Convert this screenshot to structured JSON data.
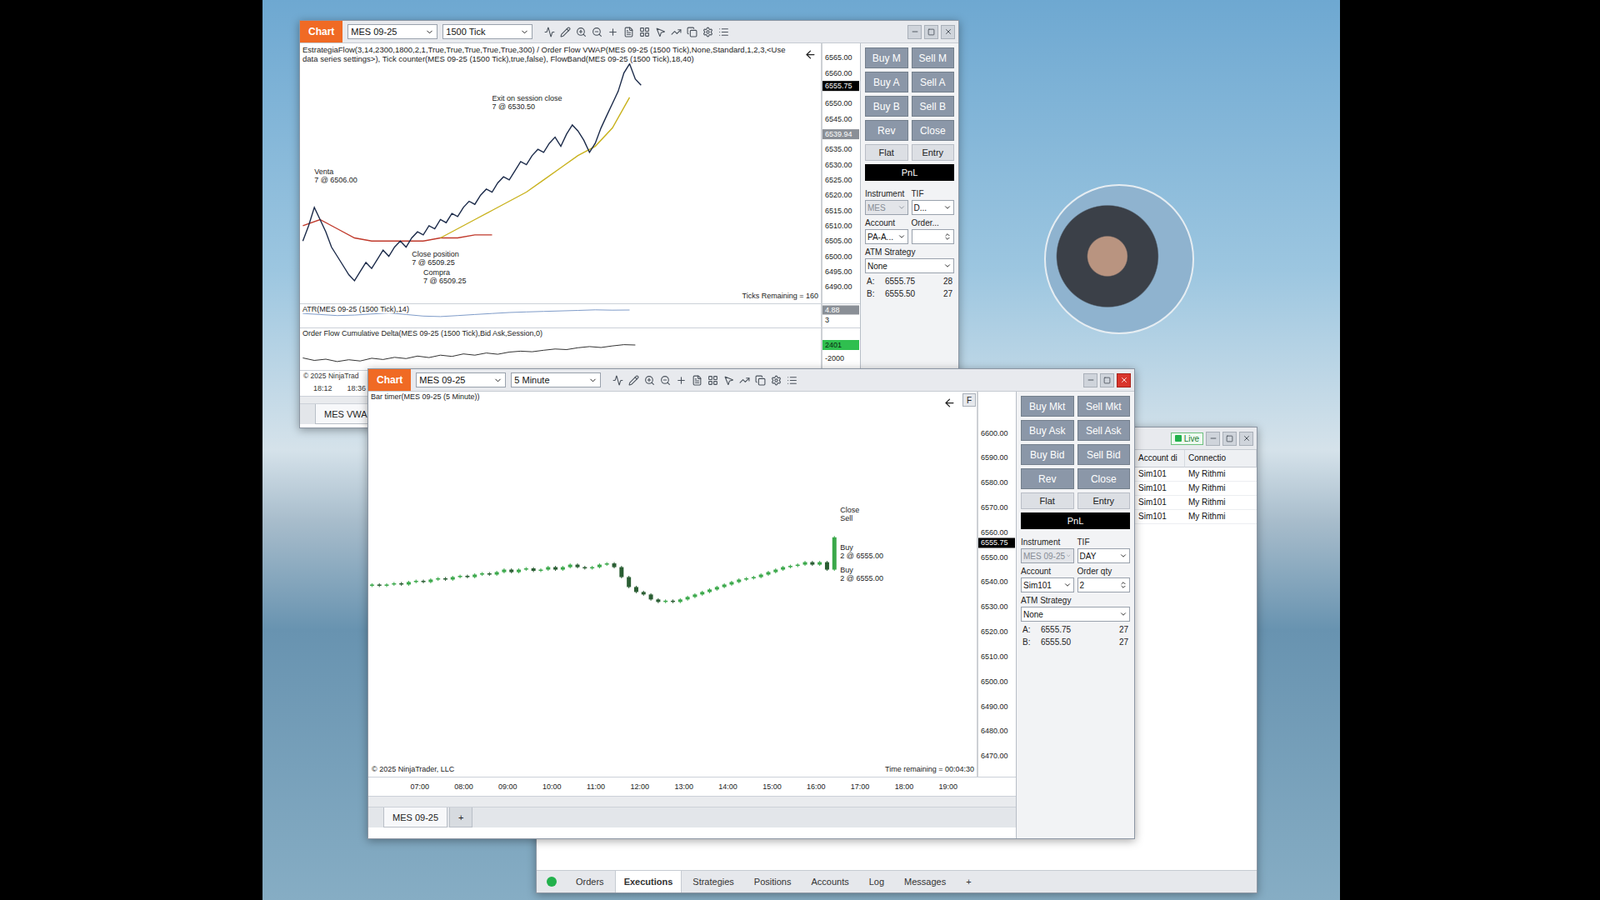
{
  "tick_chart": {
    "title": "Chart",
    "instrument": "MES 09-25",
    "interval": "1500 Tick",
    "indicator_label": "EstrategiaFlow(3,14,2300,1800,2,1,True,True,True,True,True,300) / Order Flow VWAP(MES 09-25 (1500 Tick),None,Standard,1,2,3,<Use data series settings>), Tick counter(MES 09-25 (1500 Tick),true,false), FlowBand(MES 09-25 (1500 Tick),18,40)",
    "bar_slots": 91,
    "price_axis": {
      "min": 6484.6,
      "max": 6569.7,
      "ticks": [
        "6565.00",
        "6560.00",
        "6550.00",
        "6545.00",
        "6535.00",
        "6530.00",
        "6525.00",
        "6520.00",
        "6515.00",
        "6510.00",
        "6505.00",
        "6500.00",
        "6495.00",
        "6490.00"
      ],
      "markers": [
        {
          "text": "6555.75",
          "price": 6555.75,
          "color": "#000000"
        },
        {
          "text": "6539.94",
          "price": 6539.94,
          "color": "#8a8f96"
        }
      ]
    },
    "series": [
      {
        "color": "#c0392b",
        "start_bar": 0,
        "bar_step": 3,
        "values": [
          6510,
          6512,
          6509,
          6506,
          6505,
          6505,
          6505,
          6505,
          6506,
          6506,
          6507,
          6507
        ]
      },
      {
        "color": "#c9b21c",
        "start_bar": 24,
        "bar_step": 3,
        "values": [
          6506,
          6509,
          6512,
          6515,
          6518,
          6521,
          6525,
          6529,
          6533,
          6536,
          6542,
          6552
        ]
      },
      {
        "color": "#1c2b4a",
        "start_bar": 0,
        "bar_step": 1,
        "values": [
          6505,
          6510,
          6516,
          6512,
          6508,
          6503,
          6500,
          6497,
          6494,
          6492,
          6495,
          6498,
          6496,
          6499,
          6502,
          6500,
          6503,
          6505,
          6503,
          6506,
          6508,
          6507,
          6510,
          6509,
          6512,
          6511,
          6514,
          6513,
          6516,
          6518,
          6517,
          6520,
          6522,
          6521,
          6524,
          6526,
          6525,
          6528,
          6531,
          6530,
          6533,
          6535,
          6534,
          6537,
          6539,
          6536,
          6540,
          6543,
          6541,
          6538,
          6534,
          6537,
          6542,
          6546,
          6550,
          6554,
          6560,
          6563,
          6558,
          6556
        ]
      }
    ],
    "annotations": [
      {
        "lines": [
          "Venta",
          "7 @ 6506.00"
        ],
        "bar": 2,
        "price": 6527
      },
      {
        "lines": [
          "Exit on session close",
          "7 @ 6530.50"
        ],
        "bar": 33,
        "price": 6551
      },
      {
        "lines": [
          "Close position",
          "7 @ 6509.25"
        ],
        "bar": 19,
        "price": 6500
      },
      {
        "lines": [
          "Compra",
          "7 @ 6509.25"
        ],
        "bar": 21,
        "price": 6494
      }
    ],
    "ticks_remaining": "Ticks Remaining = 160",
    "atr": {
      "label": "ATR(MES 09-25 (1500 Tick),14)",
      "min": 1.5,
      "max": 6.0,
      "axis": [
        {
          "text": "4.88",
          "value": 4.88,
          "highlight": true
        },
        {
          "text": "3",
          "value": 3,
          "highlight": false
        }
      ],
      "start_bar": 0,
      "bar_step": 3,
      "values": [
        4.2,
        4.0,
        3.8,
        3.9,
        4.1,
        4.3,
        4.0,
        3.7,
        3.6,
        3.8,
        4.0,
        4.2,
        4.4,
        4.5,
        4.6,
        4.7,
        4.8,
        4.9,
        4.85,
        4.88
      ]
    },
    "delta": {
      "label": "Order Flow Cumulative Delta(MES 09-25 (1500 Tick),Bid Ask,Session,0)",
      "min": -5724,
      "max": 7818,
      "marker": {
        "text": "2401",
        "value": 2401,
        "color": "#2fbf4f"
      },
      "axis": [
        {
          "text": "-2000",
          "value": -2000
        }
      ],
      "start_bar": 0,
      "bar_step": 2,
      "values": [
        -1800,
        -2600,
        -2200,
        -3000,
        -2400,
        -2800,
        -1900,
        -2300,
        -1600,
        -2000,
        -1200,
        -1700,
        -900,
        -1300,
        -500,
        -900,
        -200,
        -600,
        100,
        400,
        200,
        700,
        1100,
        900,
        1500,
        1900,
        1600,
        2100,
        2500,
        2401
      ]
    },
    "copyright": "© 2025 NinjaTrad",
    "time_axis": [
      "18:12",
      "18:36"
    ],
    "tabs": [
      {
        "label": "MES VWA",
        "selected": true
      }
    ],
    "trade_panel": {
      "order_buttons": [
        "Buy M",
        "Sell M",
        "Buy A",
        "Sell A",
        "Buy B",
        "Sell B",
        "Rev",
        "Close"
      ],
      "mode_buttons": [
        "Flat",
        "Entry"
      ],
      "pnl": "PnL",
      "fields": [
        {
          "label": "Instrument",
          "value": "MES",
          "disabled": true,
          "kind": "select"
        },
        {
          "label": "TIF",
          "value": "D...",
          "disabled": false,
          "kind": "select"
        },
        {
          "label": "Account",
          "value": "PA-A...",
          "disabled": false,
          "kind": "select"
        },
        {
          "label": "Order...",
          "value": "",
          "disabled": false,
          "kind": "spinner"
        }
      ],
      "atm": {
        "label": "ATM Strategy",
        "value": "None"
      },
      "quotes": [
        {
          "side": "A:",
          "price": "6555.75",
          "size": "28"
        },
        {
          "side": "B:",
          "price": "6555.50",
          "size": "27"
        }
      ]
    }
  },
  "minute_chart": {
    "title": "Chart",
    "instrument": "MES 09-25",
    "interval": "5 Minute",
    "indicator_label": "Bar timer(MES 09-25 (5 Minute))",
    "corner_button": "F",
    "slots": 83,
    "first_slot": 0.5,
    "price_axis": {
      "min": 6461.7,
      "max": 6616.6,
      "ticks": [
        "6600.00",
        "6590.00",
        "6580.00",
        "6570.00",
        "6560.00",
        "6550.00",
        "6540.00",
        "6530.00",
        "6520.00",
        "6510.00",
        "6500.00",
        "6490.00",
        "6480.00",
        "6470.00"
      ],
      "markers": [
        {
          "text": "6555.75",
          "price": 6555.75,
          "color": "#000000"
        }
      ]
    },
    "first_open": 6538.5,
    "closes": [
      6539,
      6538.5,
      6539,
      6539.5,
      6539,
      6540,
      6540.5,
      6540,
      6541,
      6541.5,
      6541,
      6542,
      6542.5,
      6542,
      6543,
      6543.5,
      6543,
      6544,
      6545,
      6544,
      6545,
      6545.5,
      6544.5,
      6545,
      6546,
      6545,
      6546,
      6547,
      6546,
      6545.5,
      6546,
      6547,
      6547.5,
      6546,
      6542,
      6538,
      6536,
      6535,
      6533,
      6532,
      6532.5,
      6532,
      6533,
      6534,
      6535,
      6536,
      6537,
      6538,
      6539,
      6540,
      6541,
      6541.5,
      6542,
      6543,
      6544,
      6545,
      6546,
      6546.5,
      6547,
      6548,
      6547,
      6548,
      6545,
      6558
    ],
    "annotations": [
      {
        "lines": [
          "Close",
          "Sell"
        ],
        "bar": 63,
        "price": 6568
      },
      {
        "lines": [
          "Buy",
          "2 @ 6555.00"
        ],
        "bar": 63,
        "price": 6553
      },
      {
        "lines": [
          "Buy",
          "2 @ 6555.00"
        ],
        "bar": 63,
        "price": 6544
      }
    ],
    "time_axis": {
      "labels": [
        "07:00",
        "08:00",
        "09:00",
        "10:00",
        "11:00",
        "12:00",
        "13:00",
        "14:00",
        "15:00",
        "16:00",
        "17:00",
        "18:00",
        "19:00"
      ],
      "first_slot": 7,
      "slot_step": 6
    },
    "copyright": "© 2025 NinjaTrader, LLC",
    "time_remaining": "Time remaining = 00:04:30",
    "tabs": [
      {
        "label": "MES 09-25",
        "selected": true
      },
      {
        "label": "+",
        "selected": false
      }
    ],
    "trade_panel": {
      "order_buttons": [
        "Buy Mkt",
        "Sell Mkt",
        "Buy Ask",
        "Sell Ask",
        "Buy Bid",
        "Sell Bid",
        "Rev",
        "Close"
      ],
      "mode_buttons": [
        "Flat",
        "Entry"
      ],
      "pnl": "PnL",
      "fields": [
        {
          "label": "Instrument",
          "value": "MES 09-25",
          "disabled": true,
          "kind": "select"
        },
        {
          "label": "TIF",
          "value": "DAY",
          "disabled": false,
          "kind": "select"
        },
        {
          "label": "Account",
          "value": "Sim101",
          "disabled": false,
          "kind": "select"
        },
        {
          "label": "Order qty",
          "value": "2",
          "disabled": false,
          "kind": "spinner"
        }
      ],
      "atm": {
        "label": "ATM Strategy",
        "value": "None"
      },
      "quotes": [
        {
          "side": "A:",
          "price": "6555.75",
          "size": "27"
        },
        {
          "side": "B:",
          "price": "6555.50",
          "size": "27"
        }
      ]
    }
  },
  "control_center": {
    "badge": "Live",
    "columns": [
      "Account di",
      "Connectio"
    ],
    "rows": [
      [
        "Sim101",
        "My Rithmi"
      ],
      [
        "Sim101",
        "My Rithmi"
      ],
      [
        "Sim101",
        "My Rithmi"
      ],
      [
        "Sim101",
        "My Rithmi"
      ]
    ],
    "status_color": "#22b14c",
    "tabs": [
      {
        "label": "Orders",
        "selected": false
      },
      {
        "label": "Executions",
        "selected": true
      },
      {
        "label": "Strategies",
        "selected": false
      },
      {
        "label": "Positions",
        "selected": false
      },
      {
        "label": "Accounts",
        "selected": false
      },
      {
        "label": "Log",
        "selected": false
      },
      {
        "label": "Messages",
        "selected": false
      },
      {
        "label": "+",
        "selected": false
      }
    ]
  }
}
